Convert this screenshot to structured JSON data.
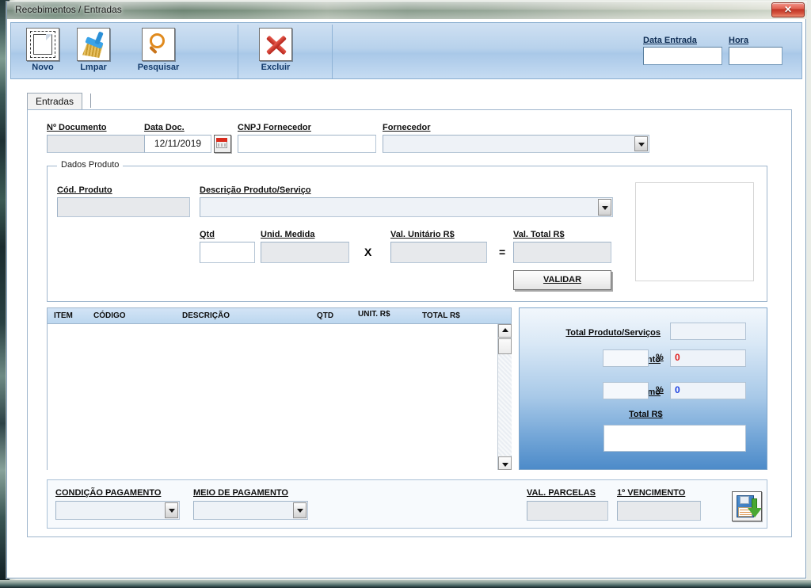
{
  "window": {
    "title": "Recebimentos / Entradas",
    "close_label": "✕"
  },
  "toolbar": {
    "buttons": [
      {
        "label": "Novo",
        "icon": "new-document-icon"
      },
      {
        "label": "Lmpar",
        "icon": "broom-icon"
      },
      {
        "label": "Pesquisar",
        "icon": "magnifier-icon"
      },
      {
        "label": "Excluir",
        "icon": "red-x-icon"
      }
    ],
    "data_entrada_label": "Data Entrada",
    "data_entrada_value": "",
    "hora_label": "Hora",
    "hora_value": ""
  },
  "tabs": [
    {
      "label": "Entradas",
      "selected": true
    }
  ],
  "header_form": {
    "num_documento_label": "Nº Documento",
    "num_documento_value": "",
    "data_doc_label": "Data Doc.",
    "data_doc_value": "12/11/2019",
    "calendar_icon": "calendar-icon",
    "cnpj_fornecedor_label": "CNPJ Fornecedor",
    "cnpj_fornecedor_value": "",
    "fornecedor_label": "Fornecedor",
    "fornecedor_value": ""
  },
  "dados_produto": {
    "group_title": "Dados Produto",
    "cod_produto_label": "Cód. Produto",
    "cod_produto_value": "",
    "descricao_label": "Descrição Produto/Serviço",
    "descricao_value": "",
    "qtd_label": "Qtd",
    "qtd_value": "",
    "unid_medida_label": "Unid. Medida",
    "unid_medida_value": "",
    "multiply_sign": "X",
    "val_unitario_label": "Val. Unitário R$",
    "val_unitario_value": "",
    "equals_sign": "=",
    "val_total_label": "Val. Total R$",
    "val_total_value": "",
    "validar_label": "VALIDAR"
  },
  "items_grid": {
    "columns": [
      "ITEM",
      "CÓDIGO",
      "DESCRIÇÃO",
      "QTD",
      "UNIT. R$",
      "TOTAL R$"
    ],
    "rows": []
  },
  "totals": {
    "total_produtos_label": "Total Produto/Serviços",
    "total_produtos_value": "",
    "desconto_label": "Desconto",
    "desconto_value": "",
    "desconto_pct_symbol": "%",
    "desconto_result": "0",
    "desconto_result_color": "#e01b1b",
    "acrescimo_label": "Acréscimo",
    "acrescimo_value": "",
    "acrescimo_pct_symbol": "%",
    "acrescimo_result": "0",
    "acrescimo_result_color": "#1b3fe0",
    "total_rs_label": "Total R$",
    "total_rs_value": ""
  },
  "payment": {
    "condicao_label": "CONDIÇÃO PAGAMENTO",
    "condicao_value": "",
    "meio_label": "MEIO DE PAGAMENTO",
    "meio_value": "",
    "val_parcelas_label": "VAL. PARCELAS",
    "val_parcelas_value": "",
    "primeiro_vencimento_label": "1º VENCIMENTO",
    "primeiro_vencimento_value": "",
    "save_icon": "save-floppy-icon"
  }
}
